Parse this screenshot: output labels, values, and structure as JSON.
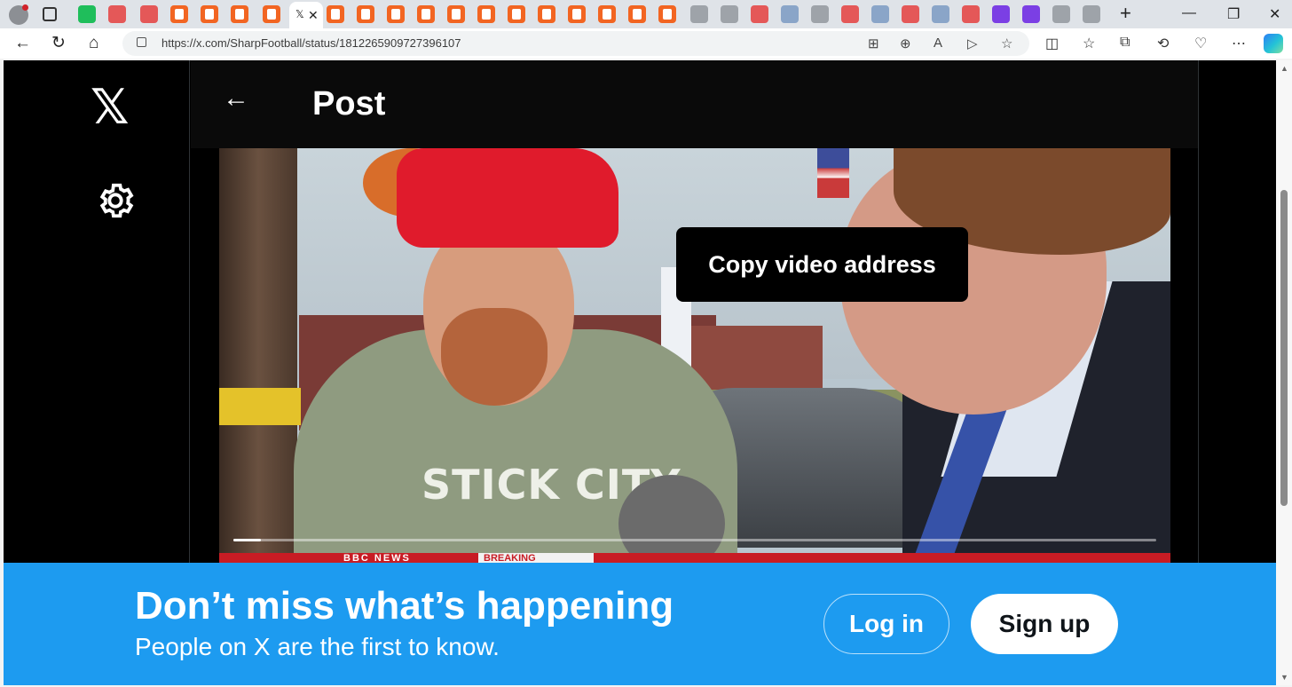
{
  "browser": {
    "url": "https://x.com/SharpFootball/status/1812265909727396107",
    "active_tab_logo": "𝕏",
    "icons": {
      "back": "back-arrow-icon",
      "refresh": "refresh-icon",
      "home": "home-icon",
      "lock": "lock-icon",
      "new_tab": "plus-icon"
    }
  },
  "sidebar": {
    "logo": "𝕏",
    "settings_icon": "gear-icon"
  },
  "header": {
    "back_glyph": "←",
    "title": "Post"
  },
  "video": {
    "shirt_text": "STICK CITY",
    "news_label": "BBC NEWS",
    "breaking_label": "BREAKING",
    "progress": 0.03,
    "tooltip": "Copy video address"
  },
  "signup_banner": {
    "title": "Don’t miss what’s happening",
    "subtitle": "People on X are the first to know.",
    "login_label": "Log in",
    "signup_label": "Sign up",
    "color": "#1d9bf0"
  }
}
